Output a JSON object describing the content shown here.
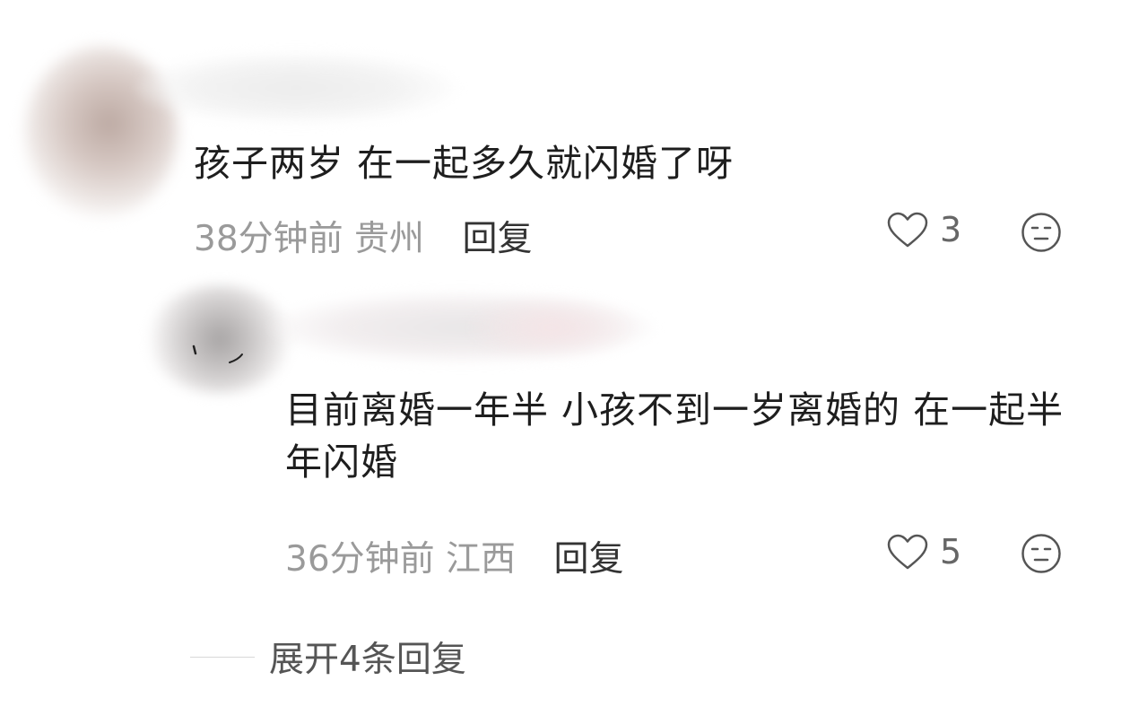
{
  "comments": [
    {
      "text": "孩子两岁 在一起多久就闪婚了呀",
      "time": "38分钟前",
      "location": "贵州",
      "reply_label": "回复",
      "likes": "3",
      "avatar": "blurred-avatar",
      "username": "blurred-username"
    },
    {
      "text": "目前离婚一年半 小孩不到一岁离婚的 在一起半年闪婚",
      "time": "36分钟前",
      "location": "江西",
      "reply_label": "回复",
      "likes": "5",
      "avatar": "blurred-avatar",
      "username": "blurred-username"
    }
  ],
  "expand_replies": {
    "label": "展开4条回复"
  },
  "icons": {
    "like": "heart-outline-icon",
    "dislike": "unamused-face-icon"
  },
  "colors": {
    "text": "#1e1e1e",
    "meta": "#9a9a9a",
    "reply": "#333333",
    "icon": "#555555"
  }
}
